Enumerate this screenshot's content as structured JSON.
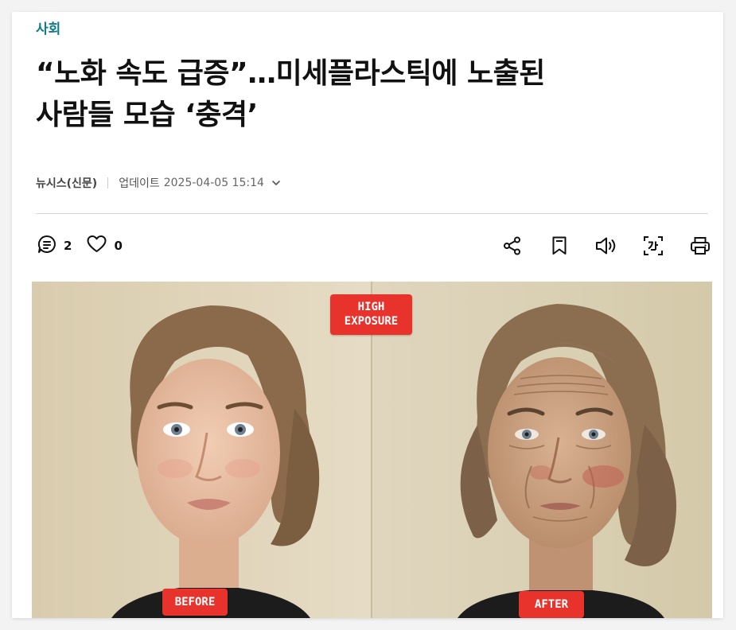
{
  "article": {
    "section": "사회",
    "headline_line1": "“노화 속도 급증”…미세플라스틱에 노출된",
    "headline_line2": "사람들 모습 ‘충격’",
    "press": "뉴시스(신문)",
    "updated_label": "업데이트",
    "updated_time": "2025-04-05 15:14"
  },
  "reactions": {
    "comment_count": "2",
    "like_count": "0"
  },
  "toolbar_icons": [
    "share-icon",
    "bookmark-icon",
    "speaker-icon",
    "text-size-icon",
    "print-icon"
  ],
  "photo": {
    "tag_high_line1": "HIGH",
    "tag_high_line2": "EXPOSURE",
    "tag_before": "BEFORE",
    "tag_after": "AFTER"
  },
  "colors": {
    "section": "#0b7d86",
    "tag": "#e8332d"
  }
}
